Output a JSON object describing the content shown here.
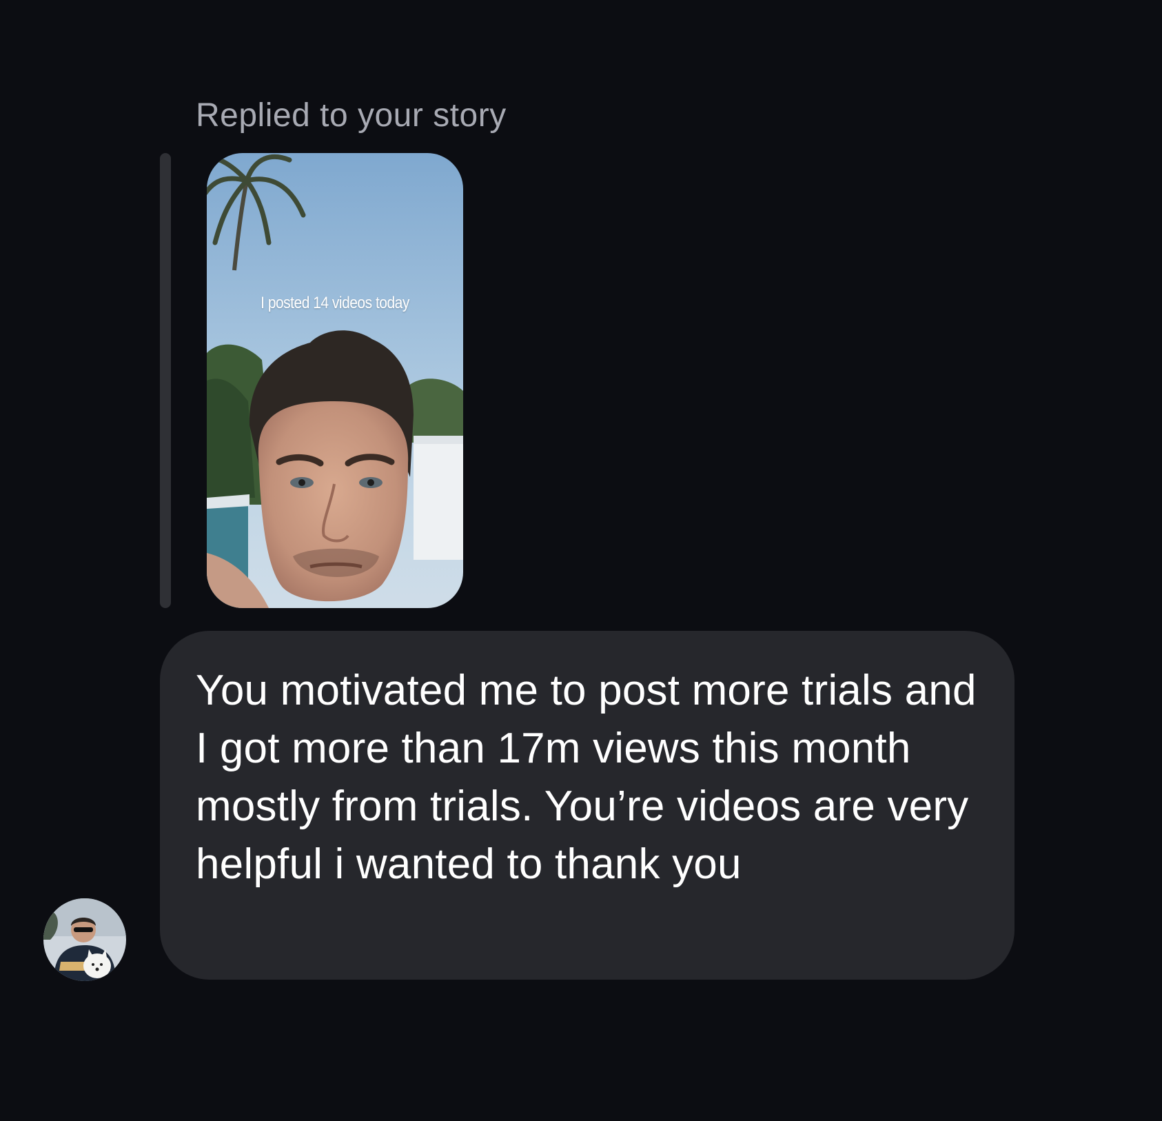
{
  "thread": {
    "reply_context": "Replied to your story",
    "story": {
      "caption": "I posted 14 videos today",
      "thumbnail": "story-photo"
    },
    "message": {
      "text": "You motivated me to post more trials and I got more than 17m views this month mostly from trials. You’re videos are very helpful i wanted to thank you"
    },
    "sender": {
      "avatar": "profile-photo"
    }
  },
  "colors": {
    "background": "#0c0d12",
    "bubble": "#26272c",
    "quote_bar": "#2f3035",
    "reply_label": "#a8aab3",
    "message_text": "#ffffff"
  }
}
